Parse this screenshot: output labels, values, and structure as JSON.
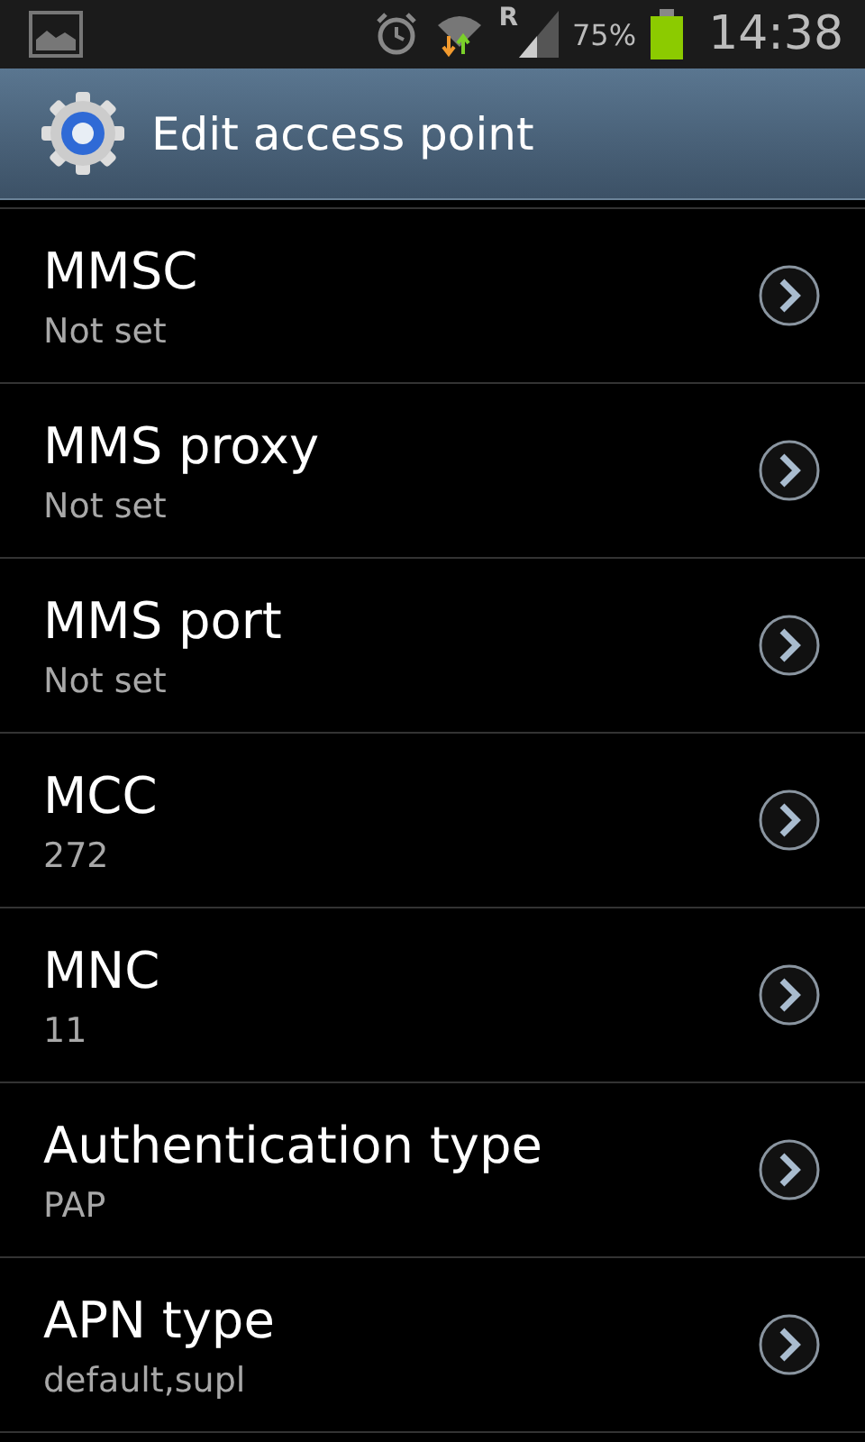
{
  "status_bar": {
    "roaming": "R",
    "battery": "75%",
    "time": "14:38"
  },
  "header": {
    "title": "Edit access point"
  },
  "items": [
    {
      "title": "MMSC",
      "value": "Not set"
    },
    {
      "title": "MMS proxy",
      "value": "Not set"
    },
    {
      "title": "MMS port",
      "value": "Not set"
    },
    {
      "title": "MCC",
      "value": "272"
    },
    {
      "title": "MNC",
      "value": "11"
    },
    {
      "title": "Authentication type",
      "value": "PAP"
    },
    {
      "title": "APN type",
      "value": "default,supl"
    }
  ]
}
